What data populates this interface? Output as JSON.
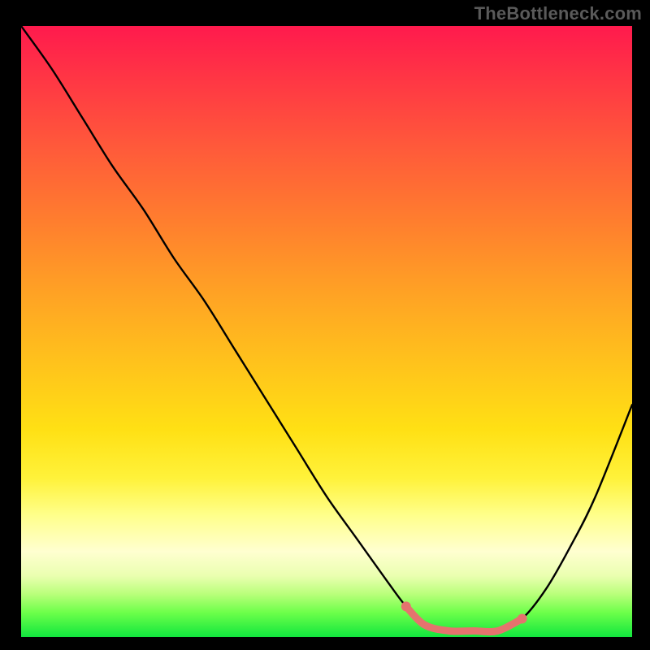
{
  "attribution": "TheBottleneck.com",
  "chart_data": {
    "type": "line",
    "title": "",
    "xlabel": "",
    "ylabel": "",
    "xlim": [
      0,
      100
    ],
    "ylim": [
      0,
      100
    ],
    "series": [
      {
        "name": "bottleneck-curve",
        "x": [
          0,
          5,
          10,
          15,
          20,
          25,
          30,
          35,
          40,
          45,
          50,
          55,
          60,
          63,
          66,
          70,
          74,
          78,
          82,
          86,
          90,
          94,
          100
        ],
        "values": [
          100,
          93,
          85,
          77,
          70,
          62,
          55,
          47,
          39,
          31,
          23,
          16,
          9,
          5,
          2,
          1,
          1,
          1,
          3,
          8,
          15,
          23,
          38
        ]
      }
    ],
    "highlight": {
      "name": "optimal-range",
      "x_start": 63,
      "x_end": 82
    },
    "background_gradient": {
      "top": "#ff1a4d",
      "mid": "#ffe014",
      "bottom": "#11e63e"
    }
  }
}
